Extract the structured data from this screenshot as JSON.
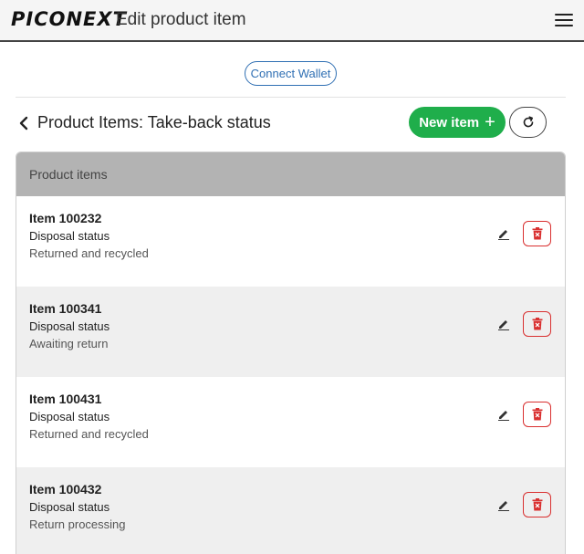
{
  "header": {
    "logo_text": "PICONEXT",
    "title": "Edit product item",
    "menu_icon": "hamburger-menu-icon"
  },
  "wallet": {
    "label": "Connect Wallet"
  },
  "page": {
    "title": "Product Items: Take-back status",
    "back_icon": "chevron-left-icon",
    "new_item_label": "New item",
    "new_item_icon": "plus-icon",
    "refresh_icon": "refresh-icon"
  },
  "panel": {
    "header": "Product items",
    "items": [
      {
        "name": "Item 100232",
        "label": "Disposal status",
        "status": "Returned and recycled"
      },
      {
        "name": "Item 100341",
        "label": "Disposal status",
        "status": "Awaiting return"
      },
      {
        "name": "Item 100431",
        "label": "Disposal status",
        "status": "Returned and recycled"
      },
      {
        "name": "Item 100432",
        "label": "Disposal status",
        "status": "Return processing"
      }
    ]
  },
  "colors": {
    "primary_green": "#1fae4b",
    "wallet_blue": "#2f6fb3",
    "delete_red": "#d93030",
    "panel_header_gray": "#b3b3b3",
    "alt_row_gray": "#efefef"
  }
}
